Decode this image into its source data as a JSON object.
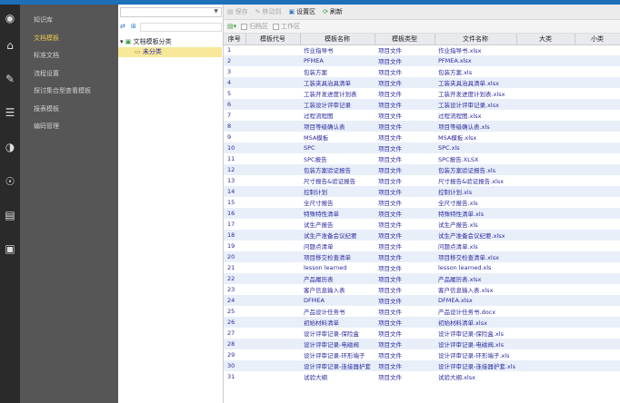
{
  "menu": {
    "items": [
      "知识库",
      "文档模板",
      "标准文档",
      "流程设置",
      "探讨集合型查看模板",
      "报表模板",
      "编码管理"
    ],
    "active": 1
  },
  "tree": {
    "root": "文档模板分类",
    "child": "未分类"
  },
  "toolbar": {
    "save": "保存",
    "move": "移动到",
    "settings": "设置区",
    "refresh": "刷新"
  },
  "filter": {
    "archive": "归档区",
    "work": "工作区"
  },
  "table": {
    "headers": [
      "序号",
      "模板代号",
      "模板名称",
      "模板类型",
      "文件名称",
      "大类",
      "小类"
    ],
    "rows": [
      [
        "1",
        "作业指导书",
        "项目文件",
        "作业指导书.xlsx"
      ],
      [
        "2",
        "PFMEA",
        "项目文件",
        "PFMEA.xlsx"
      ],
      [
        "3",
        "包装方案",
        "项目文件",
        "包装方案.xls"
      ],
      [
        "4",
        "工装夹具治具清单",
        "项目文件",
        "工装夹具治具清单.xlsx"
      ],
      [
        "5",
        "工装开发进度计划表",
        "项目文件",
        "工装开发进度计划表.xlsx"
      ],
      [
        "6",
        "工装设计评审记录",
        "项目文件",
        "工装设计评审记录.xlsx"
      ],
      [
        "7",
        "过程流程图",
        "项目文件",
        "过程流程图.xlsx"
      ],
      [
        "8",
        "项目等级确认表",
        "项目文件",
        "项目等级确认表.xls"
      ],
      [
        "9",
        "MSA模板",
        "项目文件",
        "MSA模板.xlsx"
      ],
      [
        "10",
        "SPC",
        "项目文件",
        "SPC.xls"
      ],
      [
        "11",
        "SPC报告",
        "项目文件",
        "SPC报告.XLSX"
      ],
      [
        "12",
        "包装方案验证报告",
        "项目文件",
        "包装方案验证报告.xls"
      ],
      [
        "13",
        "尺寸报告&验证报告",
        "项目文件",
        "尺寸报告&验证报告.xlsx"
      ],
      [
        "14",
        "控制计划",
        "项目文件",
        "控制计划.xls"
      ],
      [
        "15",
        "全尺寸报告",
        "项目文件",
        "全尺寸报告.xls"
      ],
      [
        "16",
        "特殊特性清单",
        "项目文件",
        "特殊特性清单.xls"
      ],
      [
        "17",
        "试生产报告",
        "项目文件",
        "试生产报告.xls"
      ],
      [
        "18",
        "试生产准备会议纪要",
        "项目文件",
        "试生产准备会议纪要.xlsx"
      ],
      [
        "19",
        "问题点清单",
        "项目文件",
        "问题点清单.xls"
      ],
      [
        "20",
        "项目移交检查清单",
        "项目文件",
        "项目移交检查清单.xlsx"
      ],
      [
        "21",
        "lesson learned",
        "项目文件",
        "lesson learned.xls"
      ],
      [
        "22",
        "产品履历表",
        "项目文件",
        "产品履历表.xlsx"
      ],
      [
        "23",
        "客户信息输入表",
        "项目文件",
        "客户信息输入表.xlsx"
      ],
      [
        "24",
        "DFMEA",
        "项目文件",
        "DFMEA.xlsx"
      ],
      [
        "25",
        "产品设计任务书",
        "项目文件",
        "产品设计任务书.docx"
      ],
      [
        "26",
        "初始材料清单",
        "项目文件",
        "初始材料清单.xlsx"
      ],
      [
        "27",
        "设计评审记录-保险盒",
        "项目文件",
        "设计评审记录-保险盒.xls"
      ],
      [
        "28",
        "设计评审记录-电磁阀",
        "项目文件",
        "设计评审记录-电磁阀.xls"
      ],
      [
        "29",
        "设计评审记录-环形端子",
        "项目文件",
        "设计评审记录-环形端子.xls"
      ],
      [
        "30",
        "设计评审记录-连接器护套",
        "项目文件",
        "设计评审记录-连接器护套.xls"
      ],
      [
        "31",
        "试验大纲",
        "项目文件",
        "试验大纲.xlsx"
      ]
    ]
  }
}
